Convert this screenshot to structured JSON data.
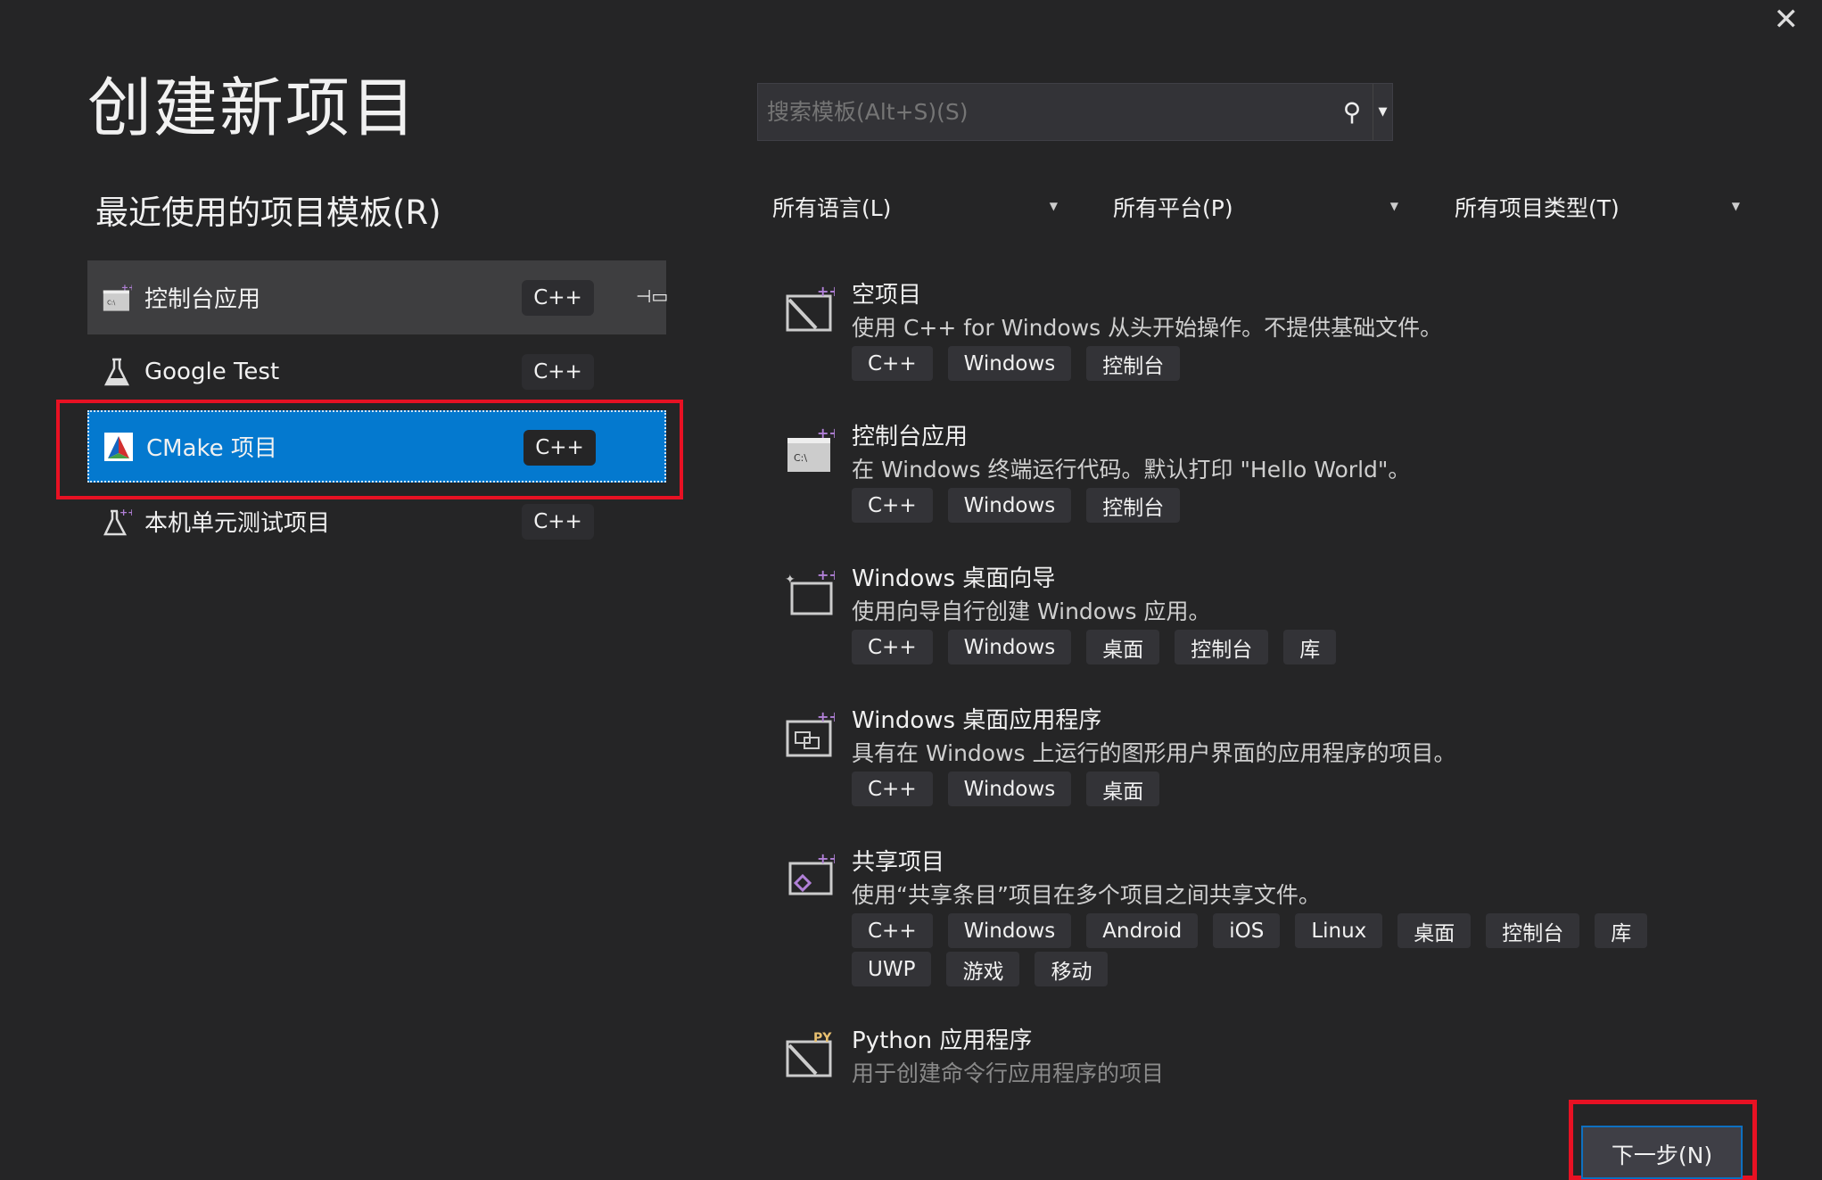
{
  "title": "创建新项目",
  "close_icon": "close-icon",
  "search": {
    "placeholder": "搜索模板(Alt+S)(S)",
    "icon": "search-icon"
  },
  "recent": {
    "heading": "最近使用的项目模板(R)",
    "items": [
      {
        "label": "控制台应用",
        "lang": "C++",
        "icon": "console-app-icon",
        "state": "hover",
        "pinned": true
      },
      {
        "label": "Google Test",
        "lang": "C++",
        "icon": "flask-icon",
        "state": ""
      },
      {
        "label": "CMake 项目",
        "lang": "C++",
        "icon": "cmake-icon",
        "state": "selected"
      },
      {
        "label": "本机单元测试项目",
        "lang": "C++",
        "icon": "flask-plus-icon",
        "state": ""
      }
    ]
  },
  "filters": [
    {
      "label": "所有语言(L)"
    },
    {
      "label": "所有平台(P)"
    },
    {
      "label": "所有项目类型(T)"
    }
  ],
  "templates": [
    {
      "name": "空项目",
      "desc": "使用 C++ for Windows 从头开始操作。不提供基础文件。",
      "tags": [
        "C++",
        "Windows",
        "控制台"
      ],
      "icon": "empty-project-icon"
    },
    {
      "name": "控制台应用",
      "desc": "在 Windows 终端运行代码。默认打印 \"Hello World\"。",
      "tags": [
        "C++",
        "Windows",
        "控制台"
      ],
      "icon": "console-app-icon"
    },
    {
      "name": "Windows 桌面向导",
      "desc": "使用向导自行创建 Windows 应用。",
      "tags": [
        "C++",
        "Windows",
        "桌面",
        "控制台",
        "库"
      ],
      "icon": "wizard-icon"
    },
    {
      "name": "Windows 桌面应用程序",
      "desc": "具有在 Windows 上运行的图形用户界面的应用程序的项目。",
      "tags": [
        "C++",
        "Windows",
        "桌面"
      ],
      "icon": "desktop-app-icon"
    },
    {
      "name": "共享项目",
      "desc": "使用“共享条目”项目在多个项目之间共享文件。",
      "tags": [
        "C++",
        "Windows",
        "Android",
        "iOS",
        "Linux",
        "桌面",
        "控制台",
        "库",
        "UWP",
        "游戏",
        "移动"
      ],
      "icon": "shared-project-icon"
    },
    {
      "name": "Python 应用程序",
      "desc": "用于创建命令行应用程序的项目",
      "tags": [],
      "icon": "python-app-icon",
      "dim": true
    }
  ],
  "next_button": "下一步(N)",
  "colors": {
    "background": "#252526",
    "selected": "#0479cf",
    "highlight_box": "#e81123",
    "accent_plus": "#b180d7"
  }
}
